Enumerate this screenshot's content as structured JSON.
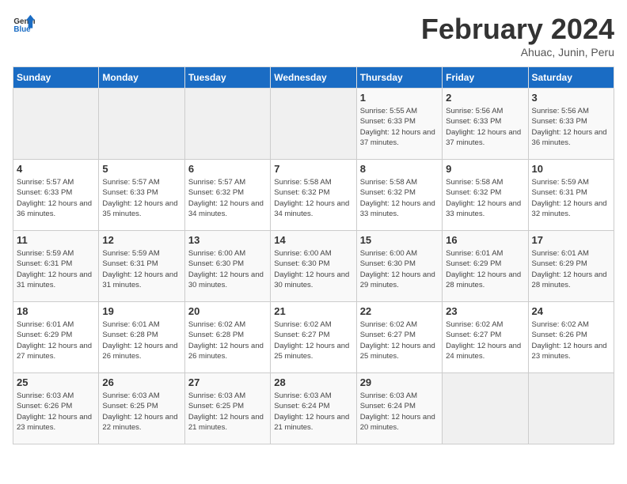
{
  "header": {
    "logo_general": "General",
    "logo_blue": "Blue",
    "month_title": "February 2024",
    "location": "Ahuac, Junin, Peru"
  },
  "weekdays": [
    "Sunday",
    "Monday",
    "Tuesday",
    "Wednesday",
    "Thursday",
    "Friday",
    "Saturday"
  ],
  "weeks": [
    [
      {
        "day": "",
        "empty": true
      },
      {
        "day": "",
        "empty": true
      },
      {
        "day": "",
        "empty": true
      },
      {
        "day": "",
        "empty": true
      },
      {
        "day": "1",
        "sunrise": "5:55 AM",
        "sunset": "6:33 PM",
        "daylight": "12 hours and 37 minutes."
      },
      {
        "day": "2",
        "sunrise": "5:56 AM",
        "sunset": "6:33 PM",
        "daylight": "12 hours and 37 minutes."
      },
      {
        "day": "3",
        "sunrise": "5:56 AM",
        "sunset": "6:33 PM",
        "daylight": "12 hours and 36 minutes."
      }
    ],
    [
      {
        "day": "4",
        "sunrise": "5:57 AM",
        "sunset": "6:33 PM",
        "daylight": "12 hours and 36 minutes."
      },
      {
        "day": "5",
        "sunrise": "5:57 AM",
        "sunset": "6:33 PM",
        "daylight": "12 hours and 35 minutes."
      },
      {
        "day": "6",
        "sunrise": "5:57 AM",
        "sunset": "6:32 PM",
        "daylight": "12 hours and 34 minutes."
      },
      {
        "day": "7",
        "sunrise": "5:58 AM",
        "sunset": "6:32 PM",
        "daylight": "12 hours and 34 minutes."
      },
      {
        "day": "8",
        "sunrise": "5:58 AM",
        "sunset": "6:32 PM",
        "daylight": "12 hours and 33 minutes."
      },
      {
        "day": "9",
        "sunrise": "5:58 AM",
        "sunset": "6:32 PM",
        "daylight": "12 hours and 33 minutes."
      },
      {
        "day": "10",
        "sunrise": "5:59 AM",
        "sunset": "6:31 PM",
        "daylight": "12 hours and 32 minutes."
      }
    ],
    [
      {
        "day": "11",
        "sunrise": "5:59 AM",
        "sunset": "6:31 PM",
        "daylight": "12 hours and 31 minutes."
      },
      {
        "day": "12",
        "sunrise": "5:59 AM",
        "sunset": "6:31 PM",
        "daylight": "12 hours and 31 minutes."
      },
      {
        "day": "13",
        "sunrise": "6:00 AM",
        "sunset": "6:30 PM",
        "daylight": "12 hours and 30 minutes."
      },
      {
        "day": "14",
        "sunrise": "6:00 AM",
        "sunset": "6:30 PM",
        "daylight": "12 hours and 30 minutes."
      },
      {
        "day": "15",
        "sunrise": "6:00 AM",
        "sunset": "6:30 PM",
        "daylight": "12 hours and 29 minutes."
      },
      {
        "day": "16",
        "sunrise": "6:01 AM",
        "sunset": "6:29 PM",
        "daylight": "12 hours and 28 minutes."
      },
      {
        "day": "17",
        "sunrise": "6:01 AM",
        "sunset": "6:29 PM",
        "daylight": "12 hours and 28 minutes."
      }
    ],
    [
      {
        "day": "18",
        "sunrise": "6:01 AM",
        "sunset": "6:29 PM",
        "daylight": "12 hours and 27 minutes."
      },
      {
        "day": "19",
        "sunrise": "6:01 AM",
        "sunset": "6:28 PM",
        "daylight": "12 hours and 26 minutes."
      },
      {
        "day": "20",
        "sunrise": "6:02 AM",
        "sunset": "6:28 PM",
        "daylight": "12 hours and 26 minutes."
      },
      {
        "day": "21",
        "sunrise": "6:02 AM",
        "sunset": "6:27 PM",
        "daylight": "12 hours and 25 minutes."
      },
      {
        "day": "22",
        "sunrise": "6:02 AM",
        "sunset": "6:27 PM",
        "daylight": "12 hours and 25 minutes."
      },
      {
        "day": "23",
        "sunrise": "6:02 AM",
        "sunset": "6:27 PM",
        "daylight": "12 hours and 24 minutes."
      },
      {
        "day": "24",
        "sunrise": "6:02 AM",
        "sunset": "6:26 PM",
        "daylight": "12 hours and 23 minutes."
      }
    ],
    [
      {
        "day": "25",
        "sunrise": "6:03 AM",
        "sunset": "6:26 PM",
        "daylight": "12 hours and 23 minutes."
      },
      {
        "day": "26",
        "sunrise": "6:03 AM",
        "sunset": "6:25 PM",
        "daylight": "12 hours and 22 minutes."
      },
      {
        "day": "27",
        "sunrise": "6:03 AM",
        "sunset": "6:25 PM",
        "daylight": "12 hours and 21 minutes."
      },
      {
        "day": "28",
        "sunrise": "6:03 AM",
        "sunset": "6:24 PM",
        "daylight": "12 hours and 21 minutes."
      },
      {
        "day": "29",
        "sunrise": "6:03 AM",
        "sunset": "6:24 PM",
        "daylight": "12 hours and 20 minutes."
      },
      {
        "day": "",
        "empty": true
      },
      {
        "day": "",
        "empty": true
      }
    ]
  ]
}
